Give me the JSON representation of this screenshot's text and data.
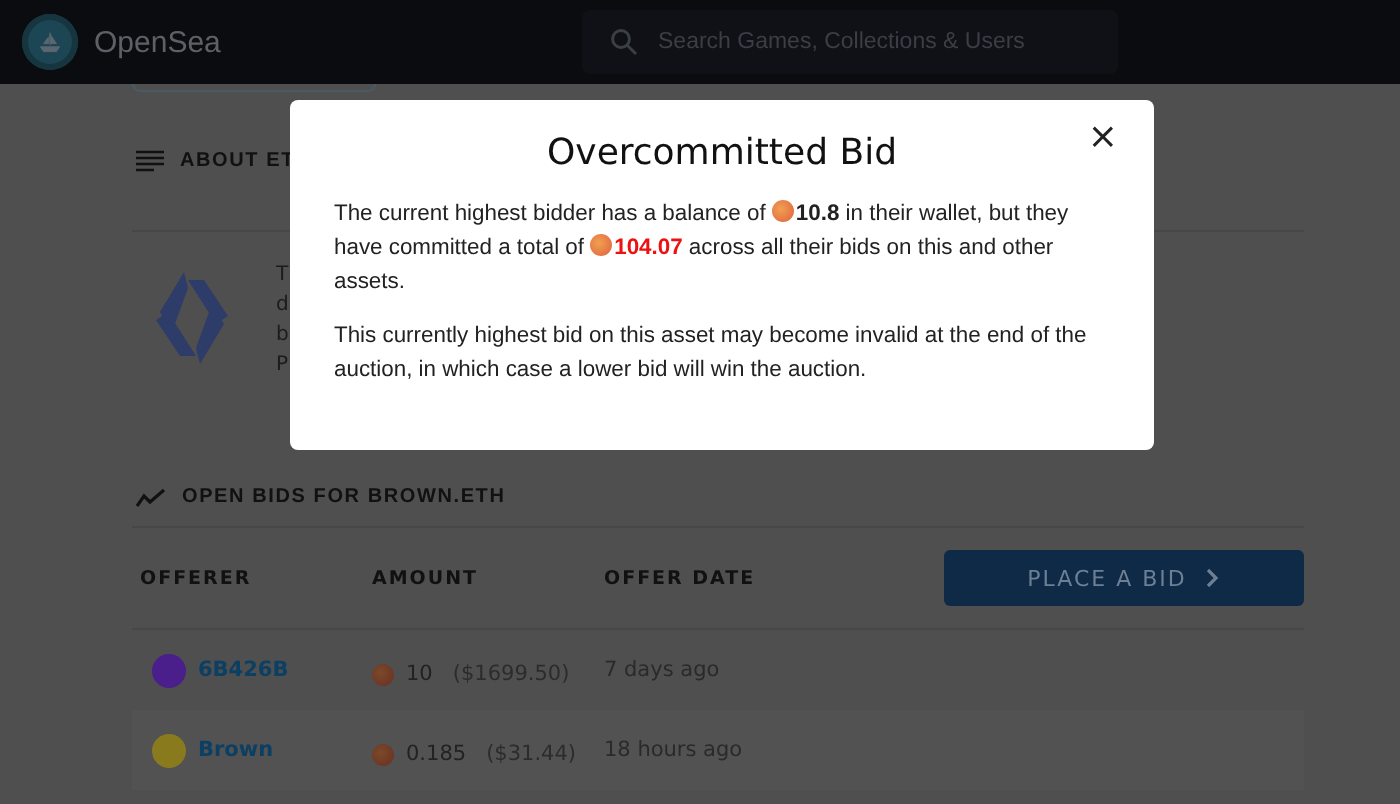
{
  "header": {
    "brand": "OpenSea",
    "search": {
      "placeholder": "Search Games, Collections & Users"
    }
  },
  "about": {
    "title": "ABOUT ET",
    "text_lines": [
      "T",
      "d",
      "b",
      "P"
    ]
  },
  "bids": {
    "title": "OPEN BIDS FOR BROWN.ETH",
    "columns": [
      "OFFERER",
      "AMOUNT",
      "OFFER DATE"
    ],
    "button": "PLACE A BID",
    "rows": [
      {
        "offerer": "6B426B",
        "color": "#4a1f8c",
        "amount": "10",
        "usd": "($1699.50)",
        "date": "7 days ago"
      },
      {
        "offerer": "Brown",
        "color": "#8a7a1e",
        "amount": "0.185",
        "usd": "($31.44)",
        "date": "18 hours ago"
      }
    ]
  },
  "modal": {
    "title": "Overcommitted Bid",
    "close": "×",
    "paragraphs": [
      {
        "segments": [
          {
            "kind": "text",
            "text": "The current highest bidder has a balance of "
          },
          {
            "kind": "amount",
            "text": "10.8"
          },
          {
            "kind": "text",
            "text": " in their wallet, but they have committed a total of "
          },
          {
            "kind": "warning",
            "text": "104.07"
          },
          {
            "kind": "text",
            "text": " across all their bids on this and other assets."
          }
        ]
      },
      {
        "segments": [
          {
            "kind": "text",
            "text": "This currently highest bid on this asset may become invalid at the end of the auction, in which case a lower bid will win the auction."
          }
        ]
      }
    ]
  }
}
